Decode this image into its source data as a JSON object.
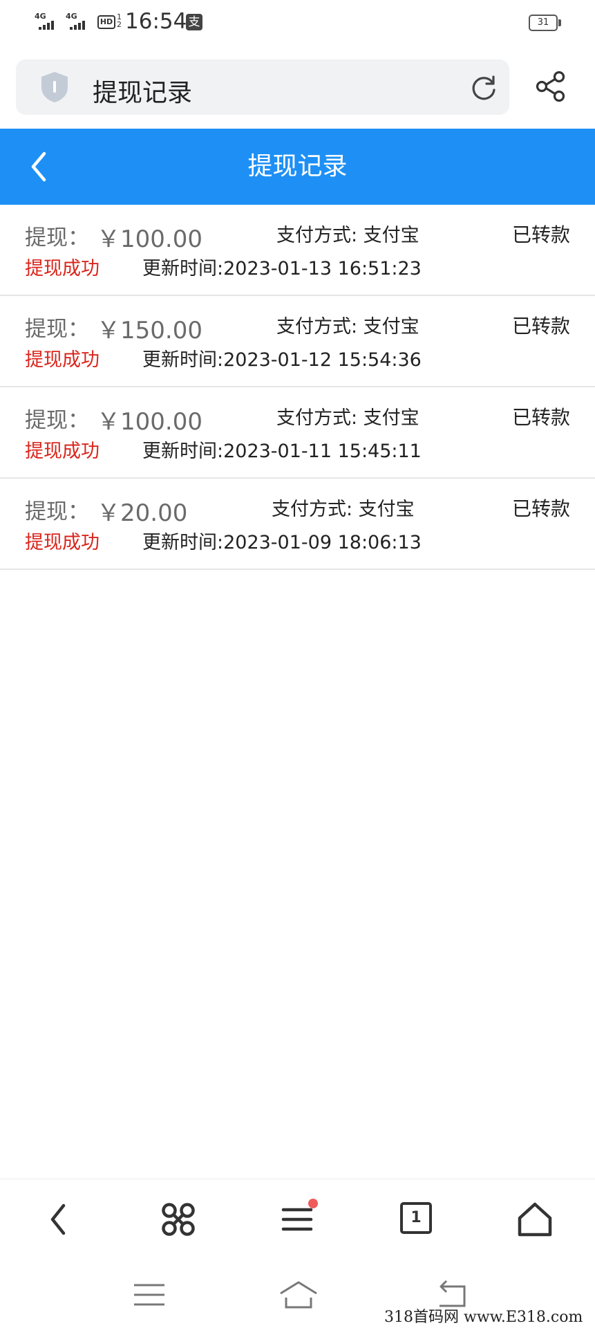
{
  "status_bar": {
    "network_1": "4G",
    "network_2": "4G",
    "hd_label": "HD",
    "hd_sub": "1\n2",
    "time": "16:54",
    "alipay_badge": "支",
    "battery": "31"
  },
  "browser": {
    "address_title": "提现记录",
    "icons": [
      "shield-icon",
      "reload-icon",
      "share-icon"
    ]
  },
  "header": {
    "title": "提现记录",
    "background": "#1e90f5"
  },
  "records": [
    {
      "label": "提现：",
      "amount": "￥100.00",
      "pay_method": "支付方式: 支付宝",
      "transfer_status": "已转款",
      "status": "提现成功",
      "update_time": "更新时间:2023-01-13 16:51:23"
    },
    {
      "label": "提现：",
      "amount": "￥150.00",
      "pay_method": "支付方式: 支付宝",
      "transfer_status": "已转款",
      "status": "提现成功",
      "update_time": "更新时间:2023-01-12 15:54:36"
    },
    {
      "label": "提现：",
      "amount": "￥100.00",
      "pay_method": "支付方式: 支付宝",
      "transfer_status": "已转款",
      "status": "提现成功",
      "update_time": "更新时间:2023-01-11 15:45:11"
    },
    {
      "label": "提现：",
      "amount": "￥20.00",
      "pay_method": "支付方式: 支付宝",
      "transfer_status": "已转款",
      "status": "提现成功",
      "update_time": "更新时间:2023-01-09 18:06:13"
    }
  ],
  "toolbar": {
    "tab_count": "1",
    "icons": [
      "back-icon",
      "command-icon",
      "menu-icon",
      "tabs-icon",
      "home-icon"
    ]
  },
  "colors": {
    "accent": "#1e90f5",
    "success_text": "#d9261c"
  },
  "watermark": "318首码网  www.E318.com"
}
